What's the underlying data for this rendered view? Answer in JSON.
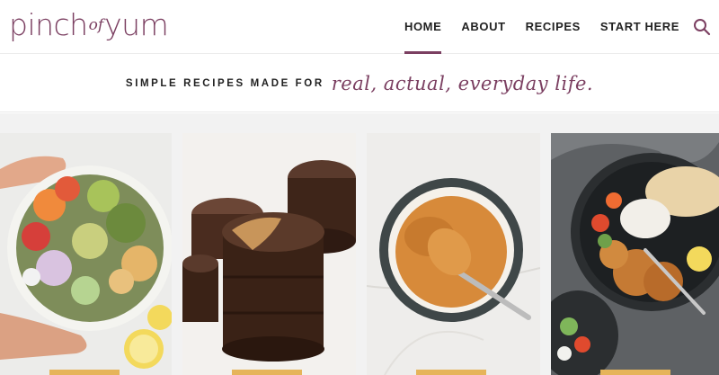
{
  "site": {
    "logo_left": "pinch",
    "logo_middle": "of",
    "logo_right": "yum"
  },
  "nav": {
    "items": [
      {
        "label": "HOME",
        "active": true
      },
      {
        "label": "ABOUT",
        "active": false
      },
      {
        "label": "RECIPES",
        "active": false
      },
      {
        "label": "START HERE",
        "active": false
      }
    ],
    "search_icon": "search-icon"
  },
  "tagline": {
    "caps": "SIMPLE RECIPES MADE FOR",
    "script": "real, actual, everyday life."
  },
  "cards": [
    {
      "name": "salad-bowl-card",
      "icon": "salad-bowl-image"
    },
    {
      "name": "peanut-butter-cups-card",
      "icon": "chocolate-cups-image"
    },
    {
      "name": "sauce-bowl-card",
      "icon": "sauce-bowl-image"
    },
    {
      "name": "chicken-plate-card",
      "icon": "chicken-plate-image"
    }
  ],
  "colors": {
    "brand": "#7b3f61",
    "accent": "#e6b45a"
  }
}
